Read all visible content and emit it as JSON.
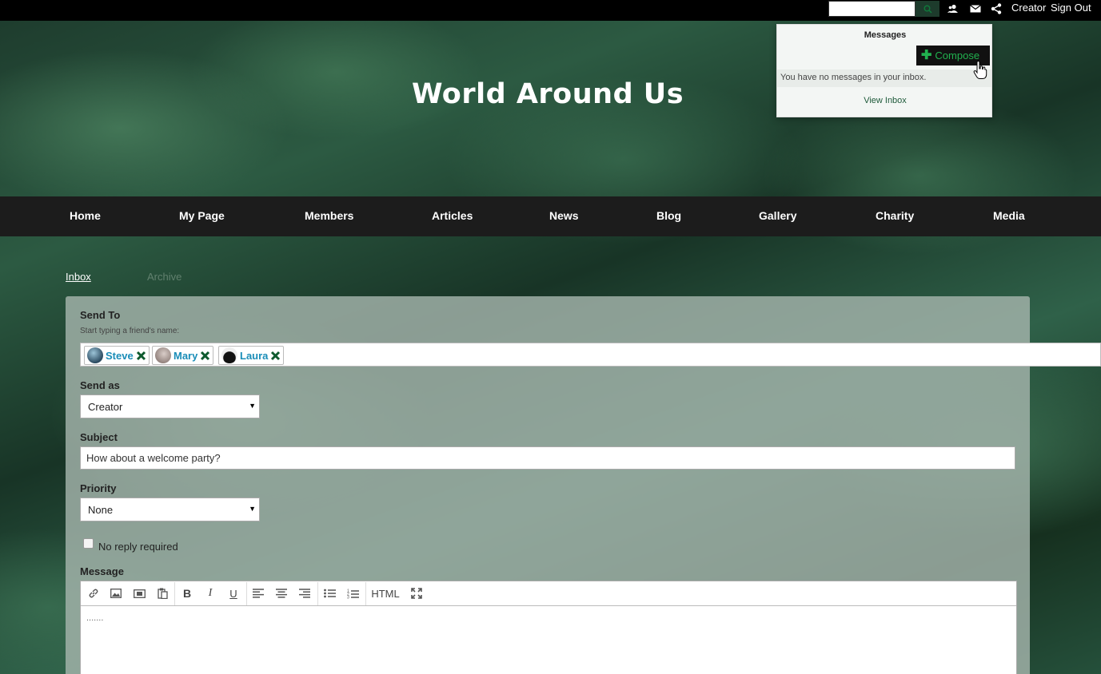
{
  "topbar": {
    "search_placeholder": "",
    "user_link": "Creator",
    "signout_link": "Sign Out"
  },
  "site": {
    "title": "World Around Us"
  },
  "messages_popup": {
    "title": "Messages",
    "compose_label": "Compose",
    "empty_text": "You have no messages in your inbox.",
    "view_inbox": "View Inbox"
  },
  "nav": {
    "items": [
      {
        "label": "Home"
      },
      {
        "label": "My Page"
      },
      {
        "label": "Members"
      },
      {
        "label": "Articles"
      },
      {
        "label": "News"
      },
      {
        "label": "Blog"
      },
      {
        "label": "Gallery"
      },
      {
        "label": "Charity"
      },
      {
        "label": "Media"
      }
    ]
  },
  "tabs": {
    "inbox": "Inbox",
    "archive": "Archive"
  },
  "form": {
    "send_to_label": "Send To",
    "send_to_hint": "Start typing a friend's name:",
    "recipients": [
      {
        "name": "Steve"
      },
      {
        "name": "Mary"
      },
      {
        "name": "Laura"
      }
    ],
    "send_as_label": "Send as",
    "send_as_value": "Creator",
    "subject_label": "Subject",
    "subject_value": "How about a welcome party?",
    "priority_label": "Priority",
    "priority_value": "None",
    "no_reply_label": "No reply required",
    "no_reply_checked": false,
    "message_label": "Message",
    "message_body": ".......",
    "toolbar_html_label": "HTML"
  },
  "colors": {
    "accent_green": "#21b14f",
    "link_blue": "#1a8db8",
    "remove_x_green": "#0e5a2e"
  }
}
